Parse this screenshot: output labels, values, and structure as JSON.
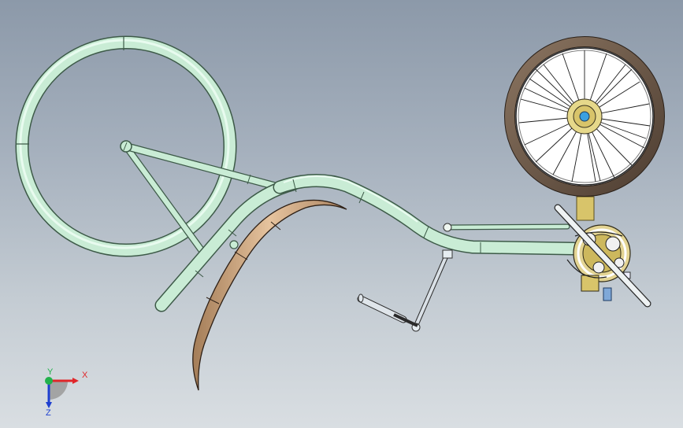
{
  "view": {
    "background_top": "#8c99a9",
    "background_bottom": "#d9dee2"
  },
  "model": {
    "frame_color": "#c9ecd5",
    "frame_outline": "#3d5a48",
    "tire_color": "#6e5a48",
    "rim_color": "#f4f4f4",
    "fender_color": "#d9b48e",
    "hub_color": "#d8c46a",
    "spoke_color": "#1c1c1c"
  },
  "triad": {
    "x_label": "X",
    "y_label": "Y",
    "z_label": "Z",
    "x_color": "#e0262a",
    "y_color": "#22b14c",
    "z_color": "#1e3fd0"
  }
}
